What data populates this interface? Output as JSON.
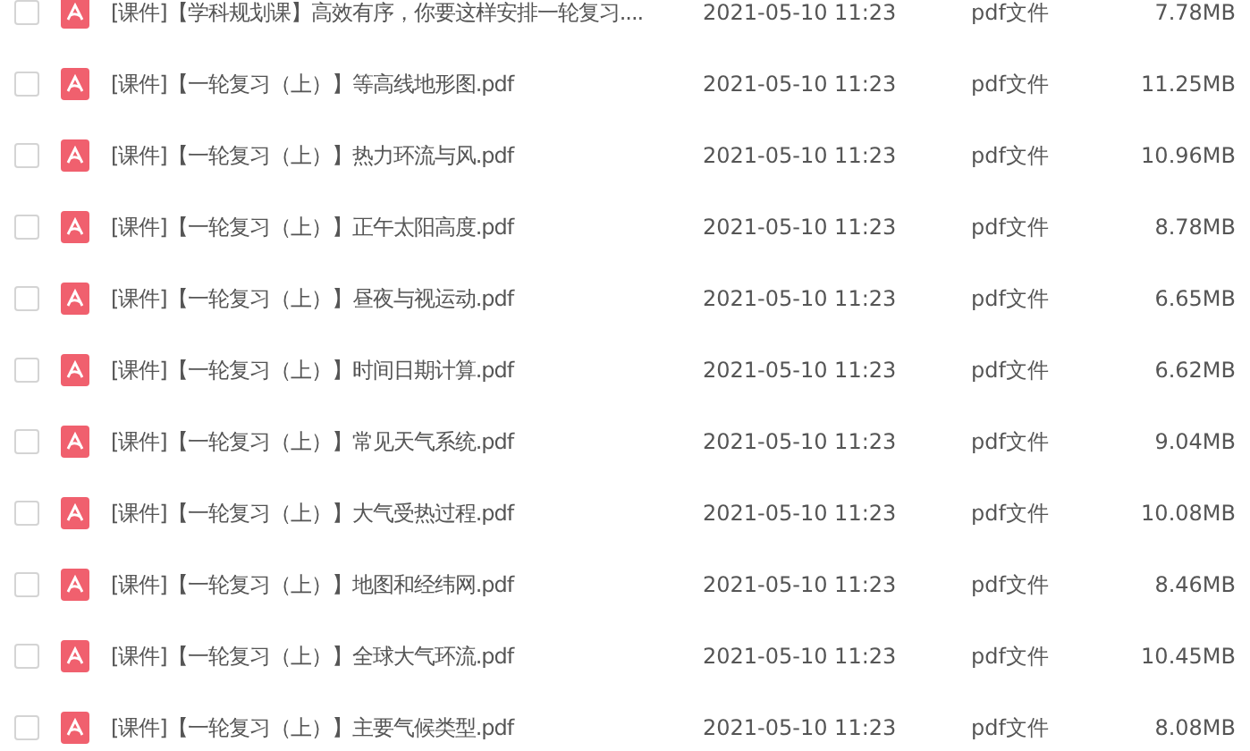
{
  "files": [
    {
      "checked": false,
      "name": "[课件]【学科规划课】高效有序，你要这样安排一轮复习....",
      "date": "2021-05-10 11:23",
      "type": "pdf文件",
      "size": "7.78MB"
    },
    {
      "checked": false,
      "name": "[课件]【一轮复习（上）】等高线地形图.pdf",
      "date": "2021-05-10 11:23",
      "type": "pdf文件",
      "size": "11.25MB"
    },
    {
      "checked": false,
      "name": "[课件]【一轮复习（上）】热力环流与风.pdf",
      "date": "2021-05-10 11:23",
      "type": "pdf文件",
      "size": "10.96MB"
    },
    {
      "checked": false,
      "name": "[课件]【一轮复习（上）】正午太阳高度.pdf",
      "date": "2021-05-10 11:23",
      "type": "pdf文件",
      "size": "8.78MB"
    },
    {
      "checked": false,
      "name": "[课件]【一轮复习（上）】昼夜与视运动.pdf",
      "date": "2021-05-10 11:23",
      "type": "pdf文件",
      "size": "6.65MB"
    },
    {
      "checked": false,
      "name": "[课件]【一轮复习（上）】时间日期计算.pdf",
      "date": "2021-05-10 11:23",
      "type": "pdf文件",
      "size": "6.62MB"
    },
    {
      "checked": false,
      "name": "[课件]【一轮复习（上）】常见天气系统.pdf",
      "date": "2021-05-10 11:23",
      "type": "pdf文件",
      "size": "9.04MB"
    },
    {
      "checked": false,
      "name": "[课件]【一轮复习（上）】大气受热过程.pdf",
      "date": "2021-05-10 11:23",
      "type": "pdf文件",
      "size": "10.08MB"
    },
    {
      "checked": false,
      "name": "[课件]【一轮复习（上）】地图和经纬网.pdf",
      "date": "2021-05-10 11:23",
      "type": "pdf文件",
      "size": "8.46MB"
    },
    {
      "checked": false,
      "name": "[课件]【一轮复习（上）】全球大气环流.pdf",
      "date": "2021-05-10 11:23",
      "type": "pdf文件",
      "size": "10.45MB"
    },
    {
      "checked": false,
      "name": "[课件]【一轮复习（上）】主要气候类型.pdf",
      "date": "2021-05-10 11:23",
      "type": "pdf文件",
      "size": "8.08MB"
    }
  ]
}
